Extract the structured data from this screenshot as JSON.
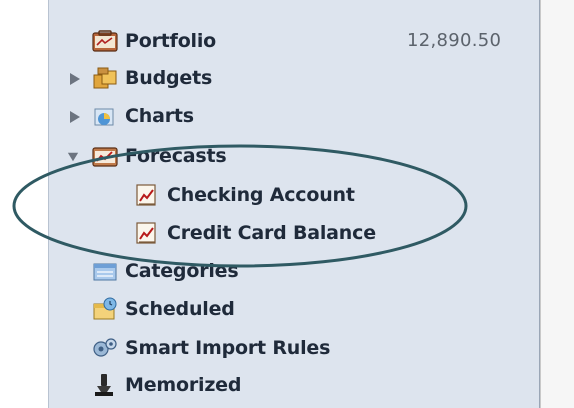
{
  "sidebar": {
    "items": [
      {
        "label": "Portfolio",
        "value": "12,890.50",
        "icon": "portfolio-icon"
      },
      {
        "label": "Budgets",
        "icon": "budgets-icon",
        "expanded": false
      },
      {
        "label": "Charts",
        "icon": "charts-icon",
        "expanded": false
      },
      {
        "label": "Forecasts",
        "icon": "forecasts-icon",
        "expanded": true,
        "children": [
          {
            "label": "Checking Account",
            "icon": "forecast-chart-icon"
          },
          {
            "label": "Credit Card Balance",
            "icon": "forecast-chart-icon"
          }
        ]
      },
      {
        "label": "Categories",
        "icon": "categories-icon"
      },
      {
        "label": "Scheduled",
        "icon": "scheduled-icon"
      },
      {
        "label": "Smart Import Rules",
        "icon": "smart-import-rules-icon"
      },
      {
        "label": "Memorized",
        "icon": "memorized-icon"
      }
    ]
  },
  "annotation": {
    "shape": "ellipse",
    "color": "#2f5a63",
    "highlights": "Forecasts children"
  }
}
